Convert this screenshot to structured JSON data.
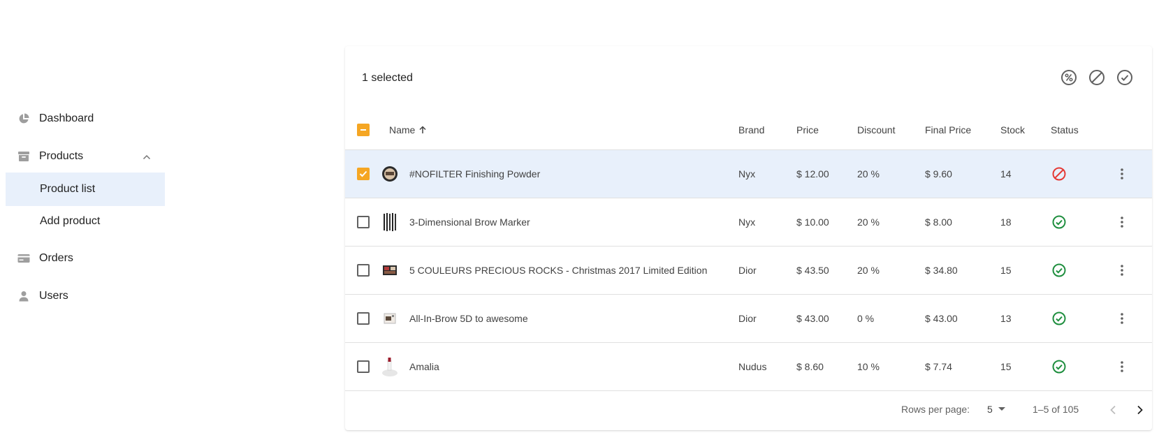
{
  "sidebar": {
    "items": [
      {
        "label": "Dashboard",
        "icon": "pie-chart-icon"
      },
      {
        "label": "Products",
        "icon": "archive-box-icon",
        "expanded": true,
        "children": [
          {
            "label": "Product list",
            "active": true
          },
          {
            "label": "Add product",
            "active": false
          }
        ]
      },
      {
        "label": "Orders",
        "icon": "credit-card-icon"
      },
      {
        "label": "Users",
        "icon": "person-icon"
      }
    ]
  },
  "table": {
    "selected_text": "1 selected",
    "actions": [
      "discount-percent-icon",
      "block-icon",
      "check-circle-icon"
    ],
    "columns": {
      "name": "Name",
      "brand": "Brand",
      "price": "Price",
      "discount": "Discount",
      "final_price": "Final Price",
      "stock": "Stock",
      "status": "Status"
    },
    "sort": {
      "column": "name",
      "direction": "asc"
    },
    "rows": [
      {
        "name": "#NOFILTER Finishing Powder",
        "brand": "Nyx",
        "price": "$ 12.00",
        "discount": "20 %",
        "final_price": "$ 9.60",
        "stock": "14",
        "status": "disabled",
        "selected": true
      },
      {
        "name": "3-Dimensional Brow Marker",
        "brand": "Nyx",
        "price": "$ 10.00",
        "discount": "20 %",
        "final_price": "$ 8.00",
        "stock": "18",
        "status": "active",
        "selected": false
      },
      {
        "name": "5 COULEURS PRECIOUS ROCKS - Christmas 2017 Limited Edition",
        "brand": "Dior",
        "price": "$ 43.50",
        "discount": "20 %",
        "final_price": "$ 34.80",
        "stock": "15",
        "status": "active",
        "selected": false
      },
      {
        "name": "All-In-Brow 5D to awesome",
        "brand": "Dior",
        "price": "$ 43.00",
        "discount": "0 %",
        "final_price": "$ 43.00",
        "stock": "13",
        "status": "active",
        "selected": false
      },
      {
        "name": "Amalia",
        "brand": "Nudus",
        "price": "$ 8.60",
        "discount": "10 %",
        "final_price": "$ 7.74",
        "stock": "15",
        "status": "active",
        "selected": false
      }
    ],
    "pagination": {
      "rows_per_page_label": "Rows per page:",
      "rows_per_page": "5",
      "range": "1–5 of 105"
    }
  },
  "colors": {
    "accent": "#f5a623",
    "selected_row": "#e8f0fb",
    "status_active": "#1e8e3e",
    "status_disabled": "#e53935",
    "icon_gray": "#616161"
  }
}
